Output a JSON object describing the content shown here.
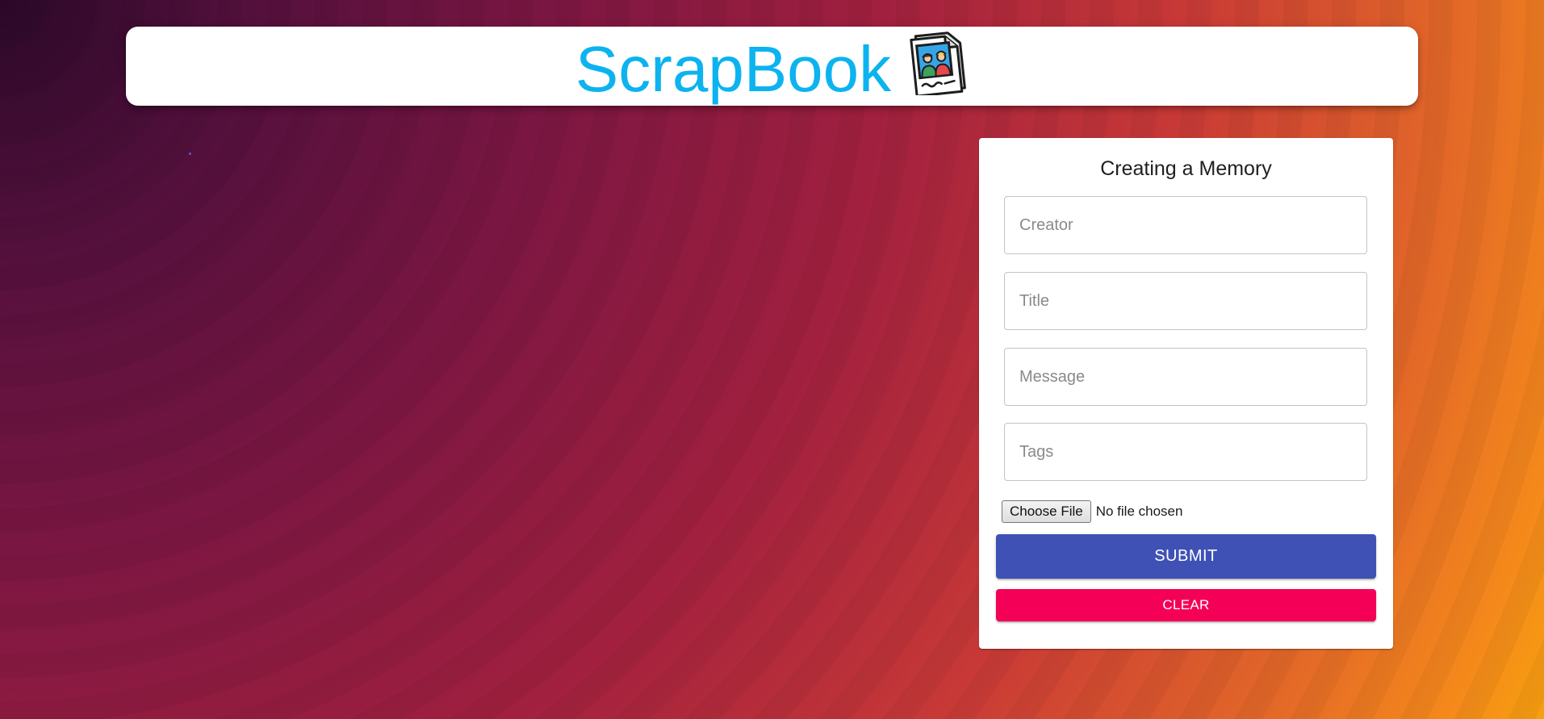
{
  "header": {
    "brand_title": "ScrapBook",
    "brand_icon": "photo-memories-icon"
  },
  "form": {
    "title": "Creating a Memory",
    "fields": {
      "creator": {
        "placeholder": "Creator",
        "value": ""
      },
      "title": {
        "placeholder": "Title",
        "value": ""
      },
      "message": {
        "placeholder": "Message",
        "value": ""
      },
      "tags": {
        "placeholder": "Tags",
        "value": ""
      }
    },
    "file_input": {
      "button_label": "Choose File",
      "status": "No file chosen"
    },
    "submit_label": "SUBMIT",
    "clear_label": "CLEAR"
  },
  "colors": {
    "brand": "#0cb3ef",
    "submit": "#3f51b5",
    "clear": "#f50057",
    "background_start": "#2b0828",
    "background_end": "#f7a010"
  }
}
